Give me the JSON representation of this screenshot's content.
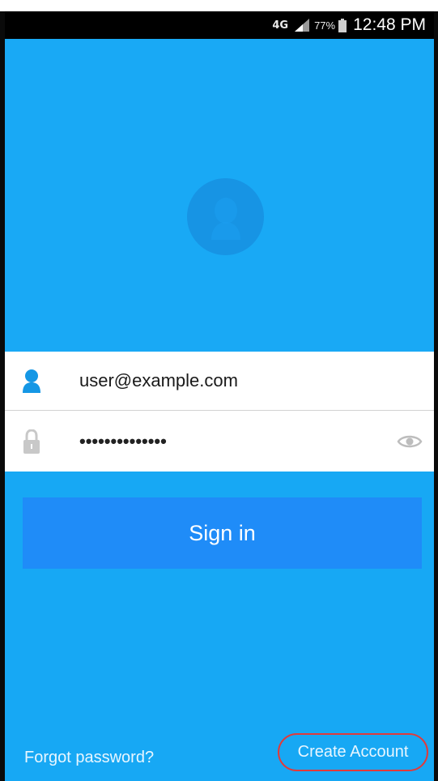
{
  "status_bar": {
    "network": "4G",
    "battery_percent": "77%",
    "time": "12:48 PM"
  },
  "avatar": {
    "icon": "user-avatar-icon"
  },
  "login_form": {
    "username": {
      "icon": "person-icon",
      "value": "user@example.com"
    },
    "password": {
      "icon": "lock-icon",
      "value": "••••••••••••••",
      "reveal_icon": "eye-icon"
    }
  },
  "sign_in_button": {
    "label": "Sign in"
  },
  "footer": {
    "forgot_password": "Forgot password?",
    "create_account": "Create Account"
  },
  "colors": {
    "background": "#17a8f4",
    "button": "#1f8cf8",
    "highlight_circle": "#e23a3a"
  }
}
